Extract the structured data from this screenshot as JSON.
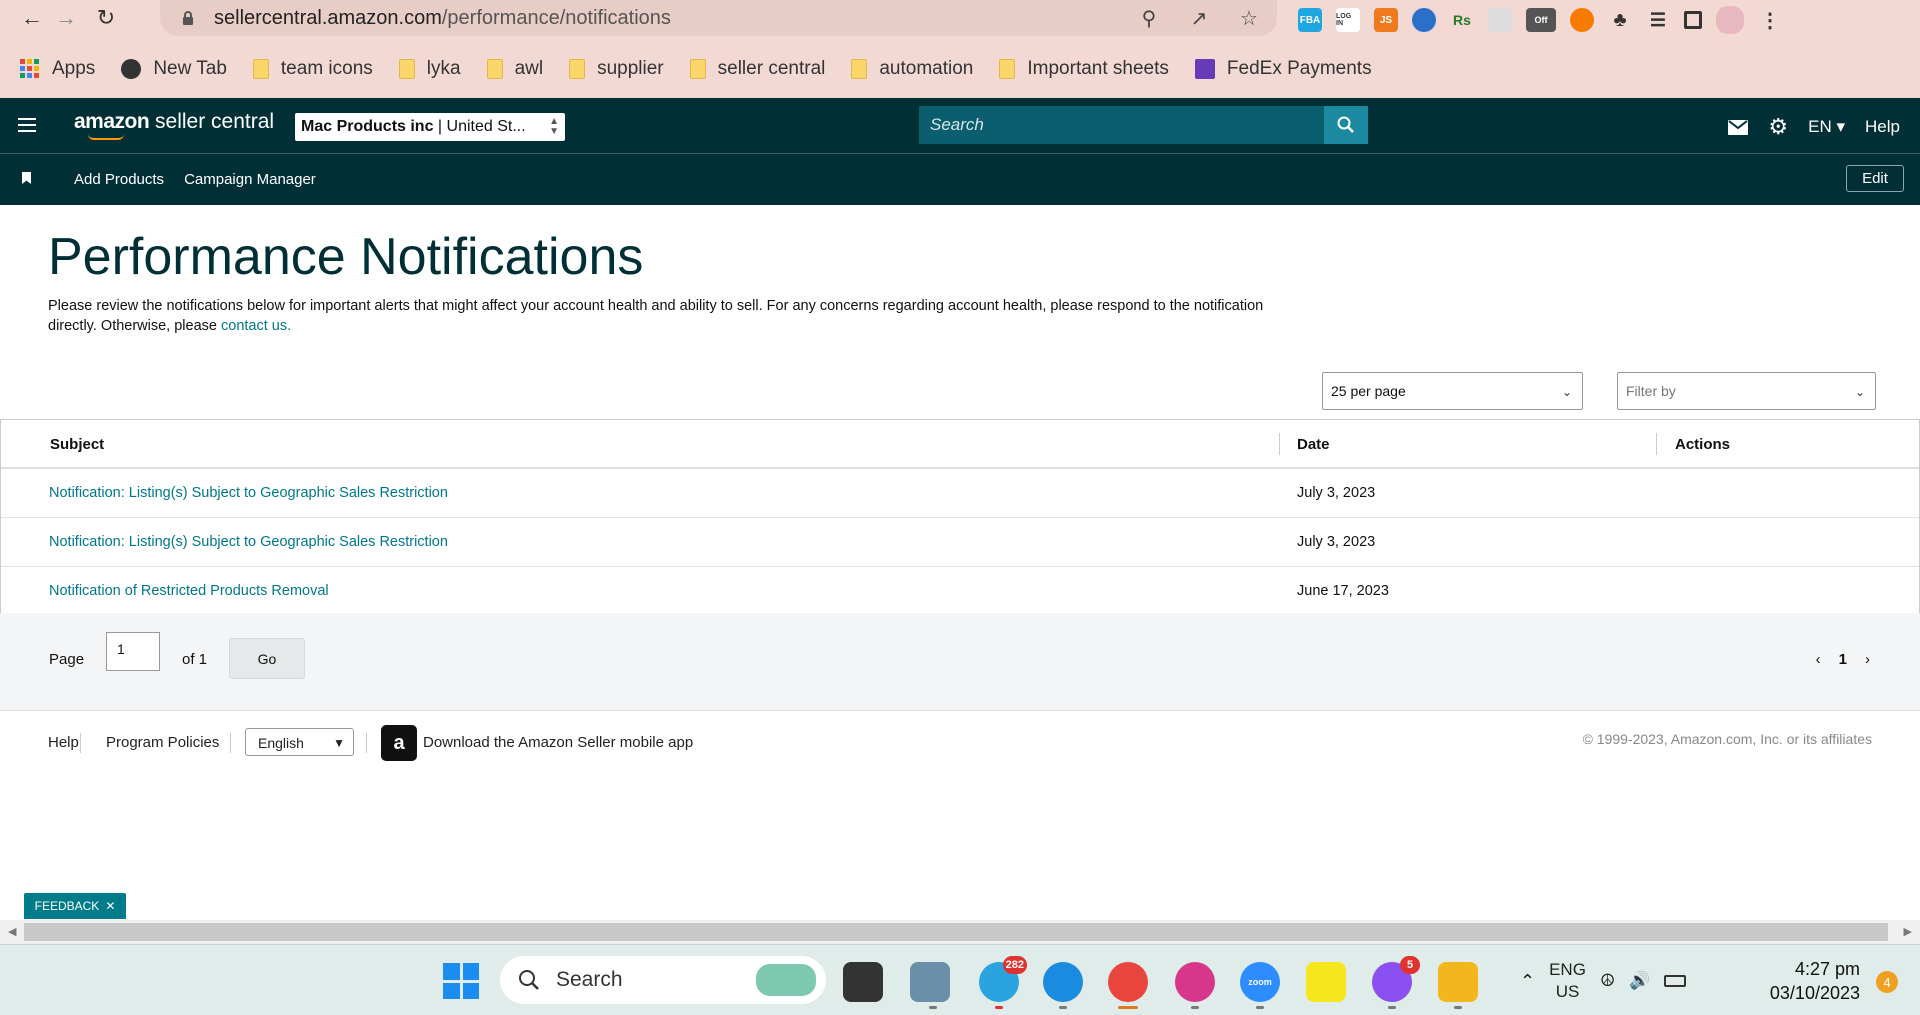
{
  "browser": {
    "url_host": "sellercentral.amazon.com",
    "url_path": "/performance/notifications",
    "extensions": [
      "FBA",
      "LOG IN",
      "JS",
      "Rs",
      "Off"
    ],
    "bookmarks": [
      {
        "label": "Apps"
      },
      {
        "label": "New Tab"
      },
      {
        "label": "team icons"
      },
      {
        "label": "lyka"
      },
      {
        "label": "awl"
      },
      {
        "label": "supplier"
      },
      {
        "label": "seller central"
      },
      {
        "label": "automation"
      },
      {
        "label": "Important sheets"
      },
      {
        "label": "FedEx Payments"
      }
    ]
  },
  "header": {
    "brand_bold": "amazon",
    "brand_rest": " seller central",
    "account_name": "Mac Products inc",
    "account_market": "United St...",
    "search_placeholder": "Search",
    "language": "EN",
    "help": "Help"
  },
  "nav": {
    "links": [
      "Add Products",
      "Campaign Manager"
    ],
    "edit": "Edit"
  },
  "page": {
    "title": "Performance Notifications",
    "intro": "Please review the notifications below for important alerts that might affect your account health and ability to sell. For any concerns regarding account health, please respond to the notification directly. Otherwise, please ",
    "contact_link": "contact us.",
    "per_page": "25 per page",
    "filter_placeholder": "Filter by"
  },
  "table": {
    "headers": {
      "subject": "Subject",
      "date": "Date",
      "actions": "Actions"
    },
    "rows": [
      {
        "subject": "Notification: Listing(s) Subject to Geographic Sales Restriction",
        "date": "July 3, 2023"
      },
      {
        "subject": "Notification: Listing(s) Subject to Geographic Sales Restriction",
        "date": "July 3, 2023"
      },
      {
        "subject": "Notification of Restricted Products Removal",
        "date": "June 17, 2023"
      }
    ]
  },
  "pager": {
    "page_label": "Page",
    "page_value": "1",
    "of_label": "of 1",
    "go": "Go",
    "current": "1"
  },
  "footer": {
    "help": "Help",
    "policies": "Program Policies",
    "language": "English",
    "app_text": "Download the Amazon Seller mobile app",
    "copyright": "© 1999-2023, Amazon.com, Inc. or its affiliates"
  },
  "feedback": {
    "label": "FEEDBACK"
  },
  "taskbar": {
    "search": "Search",
    "telegram_badge": "282",
    "messenger_badge": "5",
    "zoom_label": "zoom",
    "lang_top": "ENG",
    "lang_bottom": "US",
    "time": "4:27 pm",
    "date": "03/10/2023",
    "notifications": "4"
  },
  "colors": {
    "header_bg": "#002f36",
    "search_bg": "#0b5e6e",
    "link": "#00788a",
    "chrome_bg": "#f3d9d4"
  }
}
